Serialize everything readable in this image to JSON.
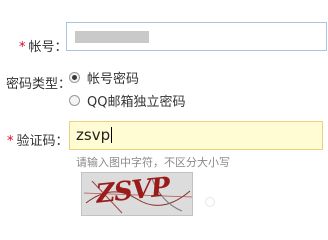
{
  "form": {
    "account": {
      "required_mark": "*",
      "label": "帐号："
    },
    "password_type": {
      "label": "密码类型：",
      "options": [
        {
          "label": "帐号密码",
          "checked": true
        },
        {
          "label": "QQ邮箱独立密码",
          "checked": false
        }
      ]
    },
    "captcha": {
      "required_mark": "*",
      "label": "验证码：",
      "value": "zsvp",
      "hint": "请输入图中字符，不区分大小写",
      "image_text": "ZSVP"
    }
  },
  "colors": {
    "required": "#e0001b",
    "input_border": "#a8c6e4",
    "focused_input_bg": "#fffbd2",
    "focused_input_border": "#ead37a"
  }
}
